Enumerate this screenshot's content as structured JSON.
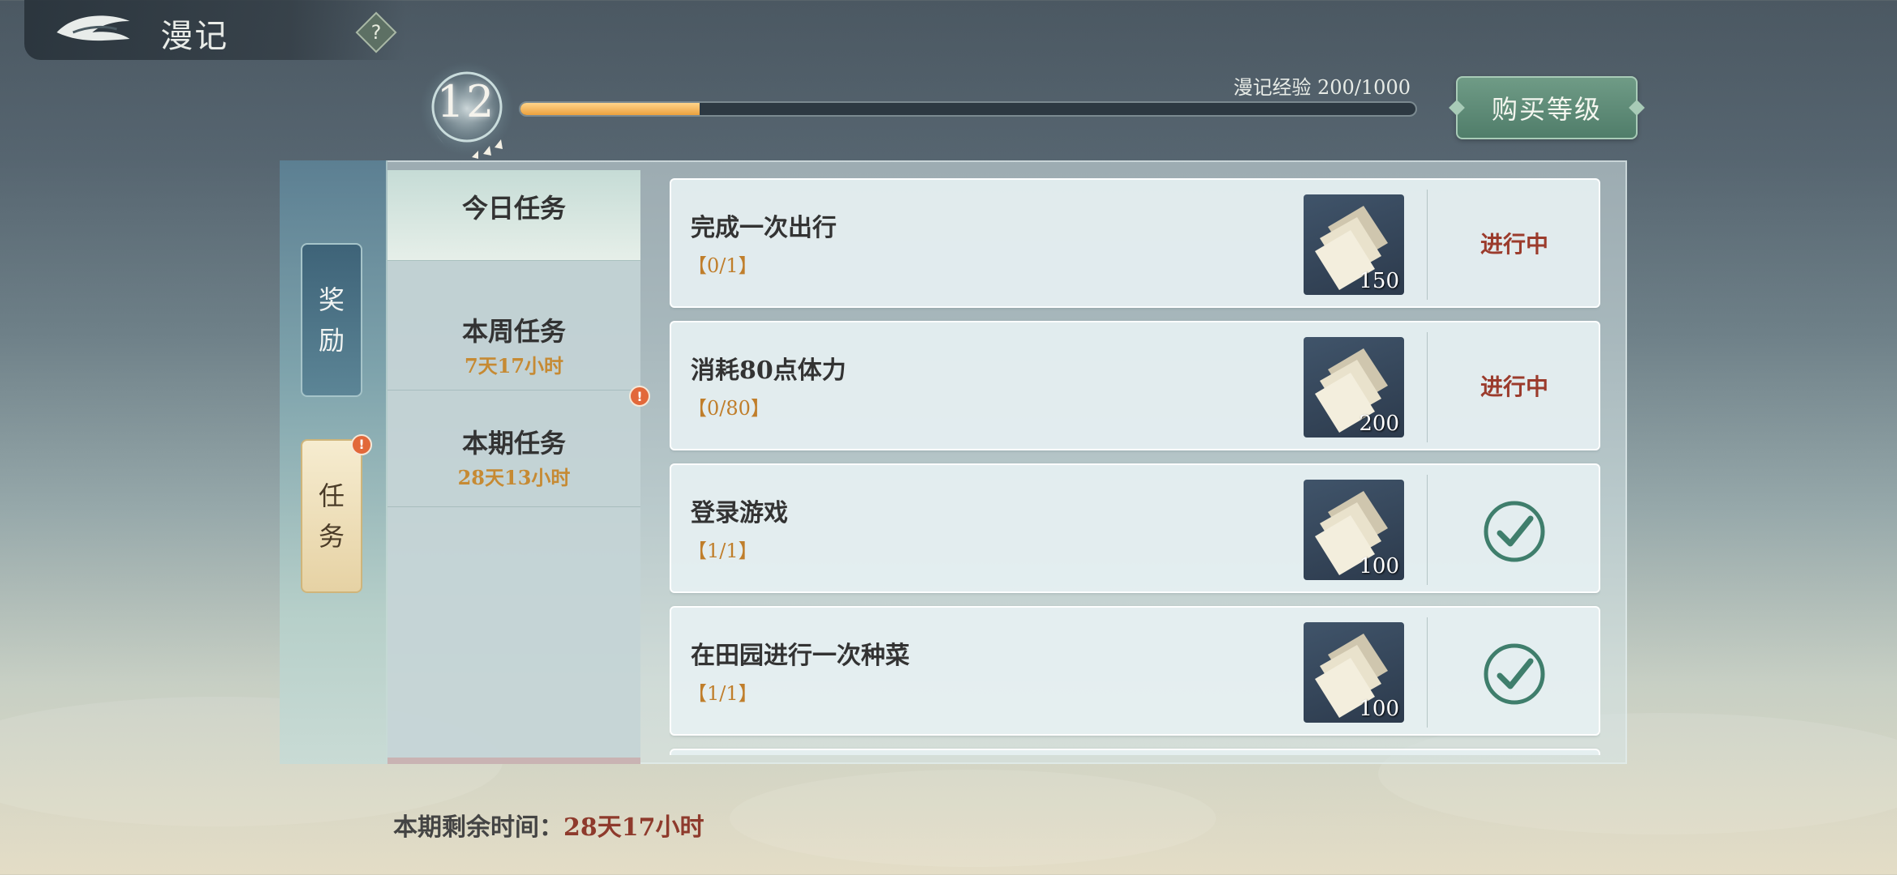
{
  "header": {
    "title": "漫记",
    "help_label": "?",
    "back_icon": "wing-back-icon"
  },
  "level": {
    "value": "12",
    "exp_label": "漫记经验 200/1000",
    "exp_fraction": 0.2
  },
  "buy_button": {
    "label": "购买等级"
  },
  "side_tabs": [
    {
      "label_line1": "奖",
      "label_line2": "励",
      "selected": false,
      "badge": false
    },
    {
      "label_line1": "任",
      "label_line2": "务",
      "selected": true,
      "badge": true
    }
  ],
  "badge_text": "!",
  "categories": [
    {
      "name": "今日任务",
      "time": "",
      "selected": true
    },
    {
      "name": "本周任务",
      "time": "7天17小时",
      "selected": false
    },
    {
      "name": "本期任务",
      "time": "28天13小时",
      "selected": false,
      "badge": true
    }
  ],
  "tasks": [
    {
      "name": "完成一次出行",
      "progress": "【0/1】",
      "reward": "150",
      "status": "进行中",
      "done": false
    },
    {
      "name": "消耗80点体力",
      "progress": "【0/80】",
      "reward": "200",
      "status": "进行中",
      "done": false
    },
    {
      "name": "登录游戏",
      "progress": "【1/1】",
      "reward": "100",
      "status": "",
      "done": true
    },
    {
      "name": "在田园进行一次种菜",
      "progress": "【1/1】",
      "reward": "100",
      "status": "",
      "done": true
    }
  ],
  "footer": {
    "remaining_label": "本期剩余时间：",
    "remaining_value": "28天17小时"
  },
  "colors": {
    "accent_orange": "#eba13e",
    "status_red": "#9b3b2c",
    "check_green": "#3f7e6c",
    "progress_orange": "#c07e2b"
  }
}
